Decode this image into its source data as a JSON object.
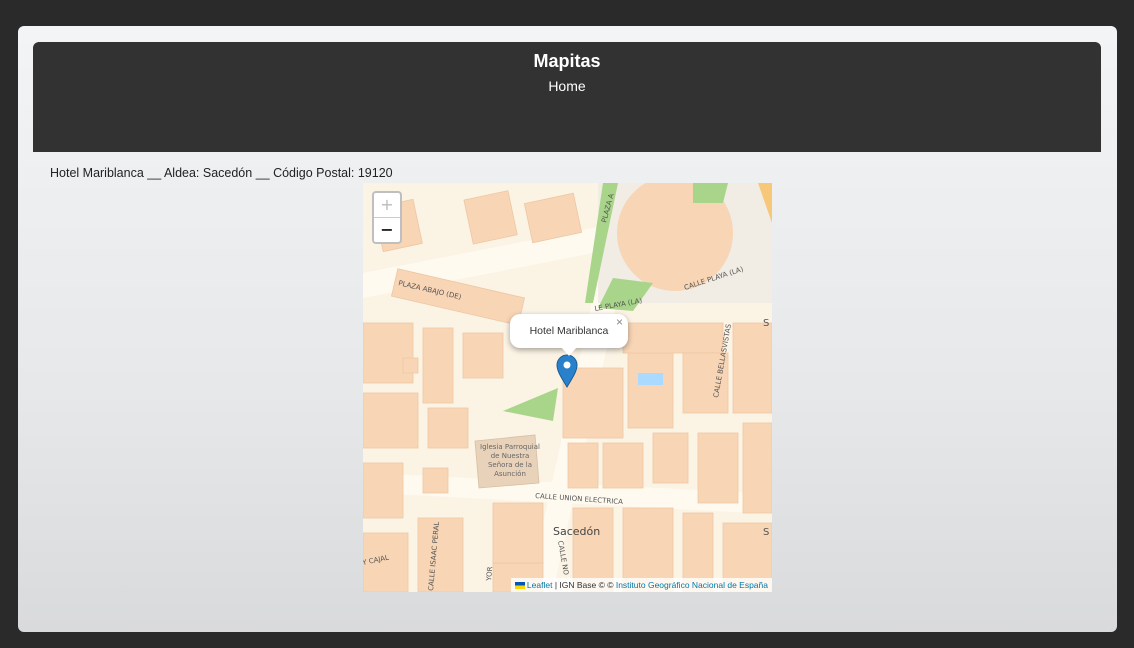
{
  "header": {
    "title": "Mapitas",
    "subtitle": "Home"
  },
  "info": {
    "text": "Hotel Mariblanca __ Aldea: Sacedón __ Código Postal: 19120"
  },
  "map": {
    "zoom_in": "+",
    "zoom_out": "−",
    "popup": {
      "text": "Hotel Mariblanca",
      "close": "×"
    },
    "labels": {
      "plaza_abajo": "PLAZA ABAJO (DE)",
      "calle_playa": "CALLE PLAYA (LA)",
      "calle_playa2": "LE PLAYA (LA)",
      "plaza_top": "PLAZA A",
      "bellasvistas": "CALLE BELLASVISTAS",
      "union": "CALLE UNION ELECTRICA",
      "sacedon": "Sacedón",
      "isaac": "CALLE ISAAC PERAL",
      "cajal": "Y CAJAL",
      "yor": "YOR",
      "calle_no": "CALLE NO",
      "s1": "S",
      "s2": "S",
      "church1": "Iglesia Parroquial",
      "church2": "de Nuestra",
      "church3": "Señora de la",
      "church4": "Asunción"
    },
    "attribution": {
      "leaflet": "Leaflet",
      "sep": " | IGN Base © © ",
      "ign": "Instituto Geográfico Nacional de España"
    },
    "colors": {
      "marker": "#2a81cb",
      "building": "#f7d5b5",
      "park": "#a8d58a"
    }
  }
}
